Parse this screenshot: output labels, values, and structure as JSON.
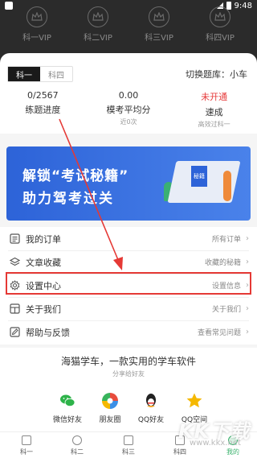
{
  "status_bar": {
    "time": "9:48"
  },
  "vip_tiers": [
    {
      "label": "科一VIP"
    },
    {
      "label": "科二VIP"
    },
    {
      "label": "科三VIP"
    },
    {
      "label": "科四VIP"
    }
  ],
  "subject_tabs": [
    {
      "label": "科一",
      "active": true
    },
    {
      "label": "科四",
      "active": false
    }
  ],
  "switch_bank": "切换题库：小车",
  "stats": [
    {
      "value": "0/2567",
      "label": "练题进度",
      "sub": ""
    },
    {
      "value": "0.00",
      "label": "模考平均分",
      "sub": "近0次"
    },
    {
      "value": "未开通",
      "label": "速成",
      "sub": "高效过科一"
    }
  ],
  "banner": {
    "line1": "解锁“考试秘籍”",
    "line2": "助力驾考过关",
    "book_label": "秘籍"
  },
  "menu": [
    {
      "icon": "list-icon",
      "label": "我的订单",
      "right": "所有订单"
    },
    {
      "icon": "layers-icon",
      "label": "文章收藏",
      "right": "收藏的秘籍"
    },
    {
      "icon": "gear-icon",
      "label": "设置中心",
      "right": "设置信息"
    },
    {
      "icon": "grid-icon",
      "label": "关于我们",
      "right": "关于我们"
    },
    {
      "icon": "feedback-icon",
      "label": "帮助与反馈",
      "right": "查看常见问题"
    }
  ],
  "share": {
    "title": "海猫学车，一款实用的学车软件",
    "subtitle": "分享给好友",
    "items": [
      {
        "label": "微信好友",
        "icon": "wechat-icon"
      },
      {
        "label": "朋友圈",
        "icon": "moments-icon"
      },
      {
        "label": "QQ好友",
        "icon": "qq-icon"
      },
      {
        "label": "QQ空间",
        "icon": "qzone-icon"
      }
    ]
  },
  "bottom_nav": [
    {
      "label": "科一",
      "active": false
    },
    {
      "label": "科二",
      "active": false
    },
    {
      "label": "科三",
      "active": false
    },
    {
      "label": "科四",
      "active": false
    },
    {
      "label": "我的",
      "active": true
    }
  ],
  "watermark": {
    "main": "KK下载",
    "url": "www.kkx.net"
  },
  "colors": {
    "header": "#2b2b2b",
    "accent_red": "#e53935",
    "banner_blue": "#2d63d8",
    "active_green": "#3bb36e"
  }
}
